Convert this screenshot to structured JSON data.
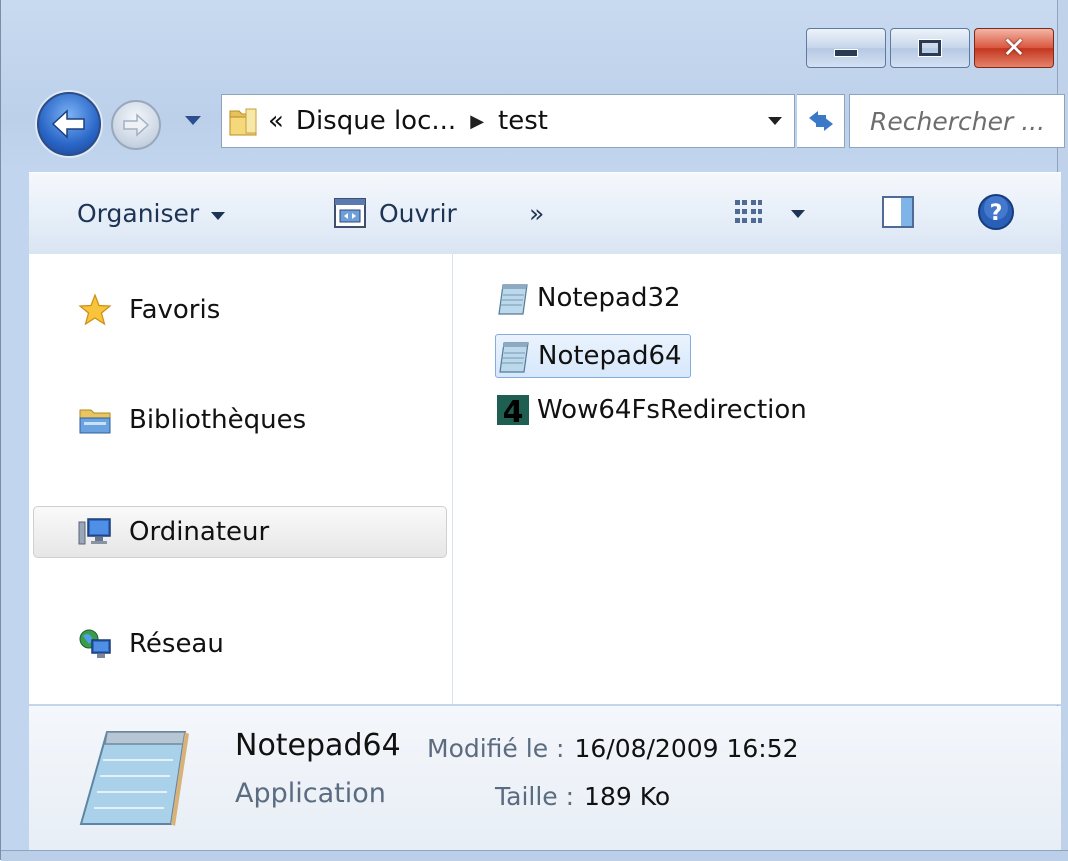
{
  "window": {
    "caption_buttons": {
      "minimize": "minimize",
      "maximize": "maximize",
      "close": "✕"
    }
  },
  "navigation": {
    "breadcrumb_prefix": "«",
    "crumbs": [
      "Disque loc...",
      "test"
    ],
    "search_placeholder": "Rechercher ..."
  },
  "toolbar": {
    "organise_label": "Organiser",
    "open_label": "Ouvrir",
    "more_label": "»"
  },
  "nav_pane": {
    "items": [
      {
        "label": "Favoris",
        "icon": "star-icon"
      },
      {
        "label": "Bibliothèques",
        "icon": "libraries-icon"
      },
      {
        "label": "Ordinateur",
        "icon": "computer-icon",
        "selected": true
      },
      {
        "label": "Réseau",
        "icon": "network-icon"
      }
    ]
  },
  "files": [
    {
      "name": "Notepad32",
      "icon": "notepad-icon"
    },
    {
      "name": "Notepad64",
      "icon": "notepad-icon",
      "selected": true
    },
    {
      "name": "Wow64FsRedirection",
      "icon": "app-4-icon"
    }
  ],
  "details": {
    "name": "Notepad64",
    "type": "Application",
    "modified_label": "Modifié le :",
    "modified_value": "16/08/2009 16:52",
    "size_label": "Taille :",
    "size_value": "189 Ko"
  },
  "colors": {
    "frame": "#c9daf0",
    "selection_border": "#84acdd",
    "selection_fill": "#d6e8fb",
    "close_red": "#d9563e"
  }
}
